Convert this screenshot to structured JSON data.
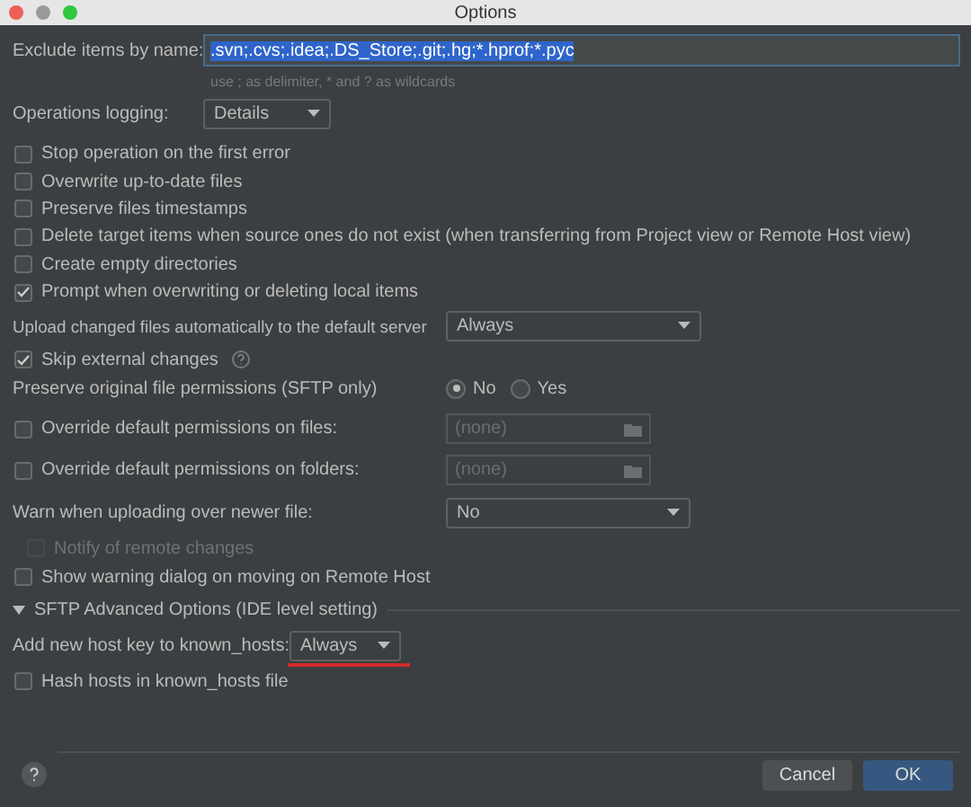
{
  "window": {
    "title": "Options"
  },
  "exclude": {
    "label": "Exclude items by name:",
    "value": ".svn;.cvs;.idea;.DS_Store;.git;.hg;*.hprof;*.pyc",
    "hint": "use ; as delimiter, * and ? as wildcards"
  },
  "logging": {
    "label": "Operations logging:",
    "value": "Details"
  },
  "options": [
    {
      "label": "Stop operation on the first error",
      "checked": false
    },
    {
      "label": "Overwrite up-to-date files",
      "checked": false
    },
    {
      "label": "Preserve files timestamps",
      "checked": false
    },
    {
      "label": "Delete target items when source ones do not exist (when transferring from Project view or Remote Host view)",
      "checked": false
    },
    {
      "label": "Create empty directories",
      "checked": false
    },
    {
      "label": "Prompt when overwriting or deleting local items",
      "checked": true
    }
  ],
  "upload": {
    "label": "Upload changed files automatically to the default server",
    "value": "Always"
  },
  "skip": {
    "label": "Skip external changes",
    "checked": true
  },
  "preserve": {
    "label": "Preserve original file permissions (SFTP only)",
    "options": [
      {
        "label": "No",
        "selected": true
      },
      {
        "label": "Yes",
        "selected": false
      }
    ]
  },
  "overrides": [
    {
      "label": "Override default permissions on files:",
      "checked": false,
      "placeholder": "(none)"
    },
    {
      "label": "Override default permissions on folders:",
      "checked": false,
      "placeholder": "(none)"
    }
  ],
  "warn": {
    "label": "Warn when uploading over newer file:",
    "value": "No"
  },
  "notify": {
    "label": "Notify of remote changes",
    "checked": false,
    "disabled": true
  },
  "show_warning": {
    "label": "Show warning dialog on moving on Remote Host",
    "checked": false
  },
  "sftp": {
    "title": "SFTP Advanced Options (IDE level setting)",
    "expanded": true,
    "host_key": {
      "label": "Add new host key to known_hosts:",
      "value": "Always",
      "underlined": true
    },
    "hash": {
      "label": "Hash hosts in known_hosts file",
      "checked": false
    }
  },
  "buttons": [
    {
      "label": "Cancel",
      "primary": false
    },
    {
      "label": "OK",
      "primary": true
    }
  ]
}
